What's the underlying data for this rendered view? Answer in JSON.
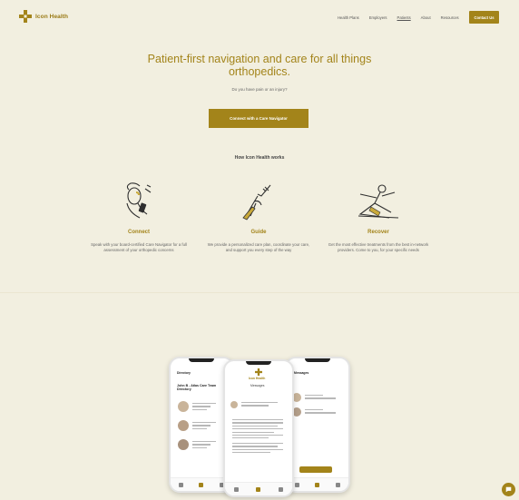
{
  "header": {
    "logo_text": "Icon Health",
    "nav_links": [
      "Health Plans",
      "Employers",
      "Patients",
      "About",
      "Resources"
    ],
    "active_link": "Patients",
    "contact_label": "Contact Us"
  },
  "hero": {
    "title": "Patient-first navigation and care for all things orthopedics.",
    "question": "Do you have pain or an injury?",
    "cta_label": "Connect with a Care Navigator"
  },
  "how": {
    "title": "How Icon Health works",
    "steps": [
      {
        "title": "Connect",
        "desc": "Speak with your board-certified Care Navigator for a full assessment of your orthopedic concerns",
        "icon": "phone-call-illustration"
      },
      {
        "title": "Guide",
        "desc": "We provide a personalized care plan, coordinate your care, and support you every step of the way",
        "icon": "helping-hands-illustration"
      },
      {
        "title": "Recover",
        "desc": "Get the most effective treatments from the best in-network providers. Come to you, for your specific needs",
        "icon": "stretching-person-illustration"
      }
    ]
  },
  "phones": {
    "left": {
      "header": "Directory",
      "title": "John B - Atlas Care Team Directory"
    },
    "center": {
      "logo": "Icon Health",
      "tab": "Messages"
    },
    "right": {
      "header": "Messages"
    }
  },
  "colors": {
    "accent": "#a3841a",
    "background": "#f2efe0"
  }
}
